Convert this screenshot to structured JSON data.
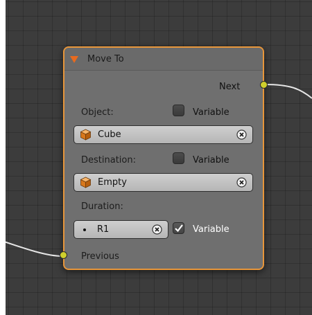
{
  "node": {
    "title": "Move To",
    "outputs": {
      "next_label": "Next"
    },
    "inputs": {
      "previous_label": "Previous"
    },
    "object": {
      "label": "Object:",
      "variable_label": "Variable",
      "variable_checked": false,
      "value": "Cube"
    },
    "destination": {
      "label": "Destination:",
      "variable_label": "Variable",
      "variable_checked": false,
      "value": "Empty"
    },
    "duration": {
      "label": "Duration:",
      "variable_label": "Variable",
      "variable_checked": true,
      "value": "R1"
    }
  },
  "colors": {
    "node_border": "#e8963a",
    "socket": "#cfcf2c",
    "collapse_arrow": "#e86a1e"
  },
  "icons": {
    "collapse": "triangle-down-icon",
    "object": "cube-icon",
    "clear": "x-circle-icon",
    "check": "checkmark-icon"
  }
}
